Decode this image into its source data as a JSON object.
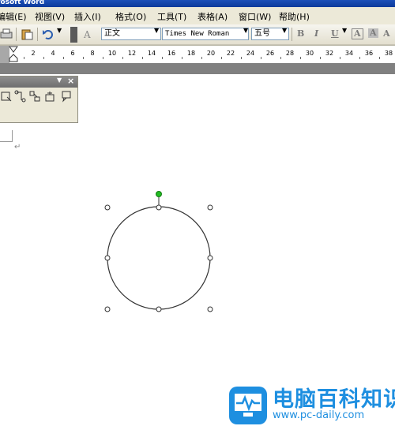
{
  "window": {
    "title": "rosoft Word"
  },
  "menubar": {
    "items": [
      {
        "label": "编辑(E)",
        "name": "menu-edit"
      },
      {
        "label": "视图(V)",
        "name": "menu-view"
      },
      {
        "label": "插入(I)",
        "name": "menu-insert"
      },
      {
        "label": "格式(O)",
        "name": "menu-format"
      },
      {
        "label": "工具(T)",
        "name": "menu-tools"
      },
      {
        "label": "表格(A)",
        "name": "menu-table"
      },
      {
        "label": "窗口(W)",
        "name": "menu-window"
      },
      {
        "label": "帮助(H)",
        "name": "menu-help"
      }
    ]
  },
  "toolbar": {
    "style_value": "正文",
    "font_value": "Times New Roman",
    "size_value": "五号",
    "bold_label": "B",
    "italic_label": "I",
    "underline_label": "U",
    "char_border_label": "A",
    "char_shading_label": "A"
  },
  "ruler": {
    "numbers": [
      "2",
      "4",
      "6",
      "8",
      "10",
      "12",
      "14",
      "16",
      "18",
      "20",
      "22",
      "24",
      "26",
      "28",
      "30",
      "32",
      "34",
      "36",
      "38"
    ]
  },
  "floating_toolbar": {
    "icons": [
      "shape-icon",
      "connector-icon",
      "align-icon",
      "rotate-icon",
      "callout-icon"
    ]
  },
  "document": {
    "paragraph_mark": "↵"
  },
  "watermark": {
    "title": "电脑百科知识",
    "url": "www.pc-daily.com"
  },
  "colors": {
    "title_bar": "#0b3a9b",
    "menu_bg": "#ece9d8",
    "rotate_handle": "#22bb22",
    "watermark": "#1e8fe0"
  }
}
